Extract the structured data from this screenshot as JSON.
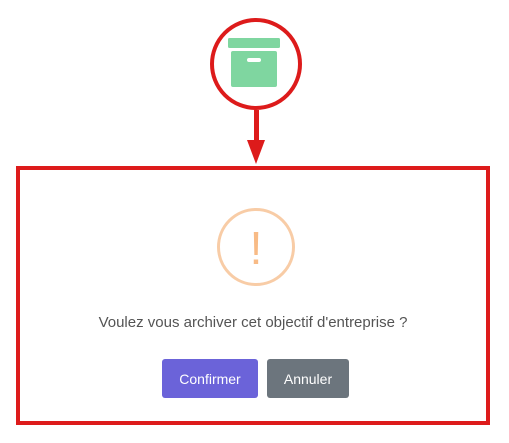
{
  "dialog": {
    "message": "Voulez vous archiver cet objectif d'entreprise ?",
    "confirm_label": "Confirmer",
    "cancel_label": "Annuler",
    "warning_glyph": "!"
  },
  "icons": {
    "top": "archive-box-icon",
    "dialog": "warning-icon"
  },
  "colors": {
    "archive_icon": "#7fd6a0",
    "highlight": "#dd1b1b",
    "warning": "#f8cca6",
    "confirm_button": "#6b63d9",
    "cancel_button": "#6c757d",
    "message_text": "#545454"
  }
}
